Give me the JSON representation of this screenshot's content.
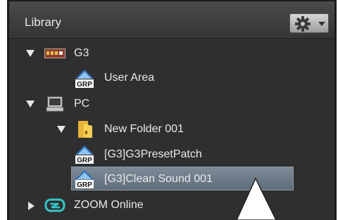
{
  "header": {
    "title": "Library"
  },
  "tree": {
    "g3": {
      "label": "G3"
    },
    "user_area": {
      "label": "User Area"
    },
    "pc": {
      "label": "PC"
    },
    "new_folder": {
      "label": "New Folder 001"
    },
    "preset_patch": {
      "label": "[G3]G3PresetPatch"
    },
    "clean_sound": {
      "label": "[G3]Clean Sound 001"
    },
    "zoom_online": {
      "label": "ZOOM Online"
    }
  },
  "icons": {
    "grp_text": "GRP"
  },
  "colors": {
    "panel": "#2f2f2f",
    "selection": "#6f7c89",
    "zoom_teal": "#33c6c6"
  }
}
